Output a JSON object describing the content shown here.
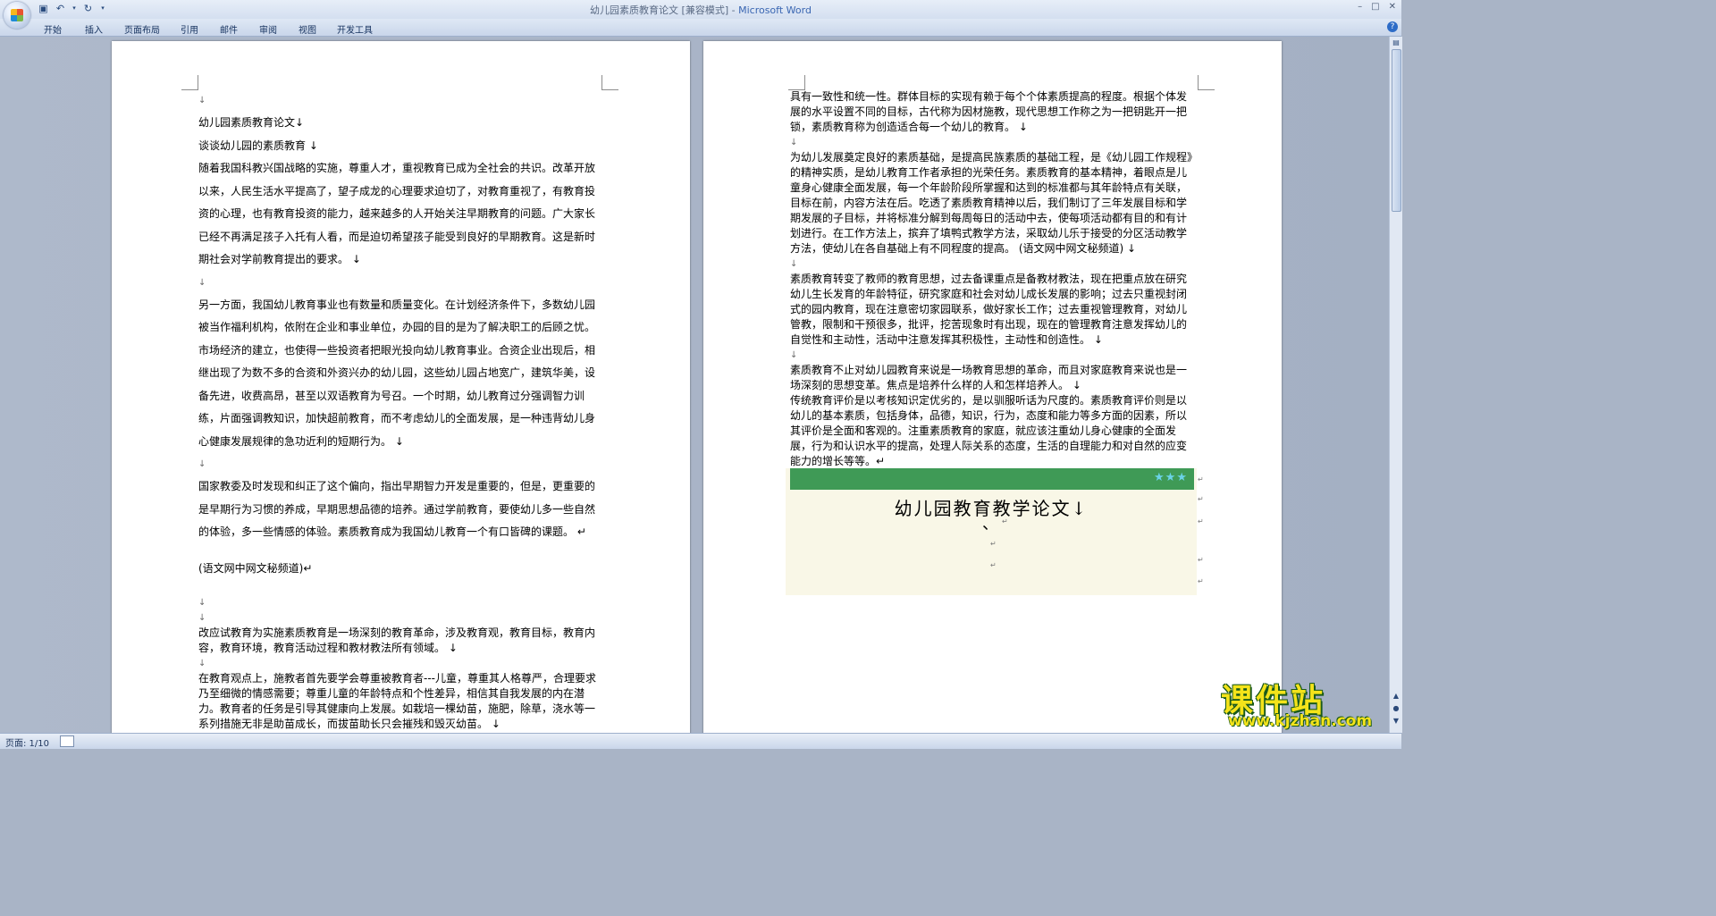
{
  "window": {
    "title": "幼儿园素质教育论文 [兼容模式] - ",
    "app_name": "Microsoft Word"
  },
  "ribbon": {
    "tabs": [
      "开始",
      "插入",
      "页面布局",
      "引用",
      "邮件",
      "审阅",
      "视图",
      "开发工具"
    ]
  },
  "page1": {
    "p1": "幼儿园素质教育论文↓",
    "p2": "谈谈幼儿园的素质教育 ↓",
    "p3": "随着我国科教兴国战略的实施，尊重人才，重视教育已成为全社会的共识。改革开放以来，人民生活水平提高了，望子成龙的心理要求迫切了，对教育重视了，有教育投资的心理，也有教育投资的能力，越来越多的人开始关注早期教育的问题。广大家长已经不再满足孩子入托有人看，而是迫切希望孩子能受到良好的早期教育。这是新时期社会对学前教育提出的要求。 ↓",
    "p4": "另一方面，我国幼儿教育事业也有数量和质量变化。在计划经济条件下，多数幼儿园被当作福利机构，依附在企业和事业单位，办园的目的是为了解决职工的后顾之忧。市场经济的建立，也使得一些投资者把眼光投向幼儿教育事业。合资企业出现后，相继出现了为数不多的合资和外资兴办的幼儿园，这些幼儿园占地宽广，建筑华美，设备先进，收费高昂，甚至以双语教育为号召。一个时期，幼儿教育过分强调智力训练，片面强调教知识，加快超前教育，而不考虑幼儿的全面发展，是一种违背幼儿身心健康发展规律的急功近利的短期行为。 ↓",
    "p5": "国家教委及时发现和纠正了这个偏向，指出早期智力开发是重要的，但是，更重要的是早期行为习惯的养成，早期思想品德的培养。通过学前教育，要使幼儿多一些自然的体验，多一些情感的体验。素质教育成为我国幼儿教育一个有口皆碑的课题。 ↵",
    "p6": "(语文网中网文秘频道)↵",
    "p7": "改应试教育为实施素质教育是一场深刻的教育革命，涉及教育观，教育目标，教育内容，教育环境，教育活动过程和教材教法所有领域。 ↓",
    "p8": "在教育观点上，施教者首先要学会尊重被教育者---儿童，尊重其人格尊严，合理要求乃至细微的情感需要；尊重儿童的年龄特点和个性差异，相信其自我发展的内在潜力。教育者的任务是引导其健康向上发展。如栽培一棵幼苗，施肥，除草，浇水等一系列措施无非是助苗成长，而拔苗助长只会摧残和毁灭幼苗。 ↓",
    "arrow": "↓"
  },
  "page2": {
    "q1": "具有一致性和统一性。群体目标的实现有赖于每个个体素质提高的程度。根据个体发展的水平设置不同的目标，古代称为因材施教，现代思想工作称之为一把钥匙开一把锁，素质教育称为创造适合每一个幼儿的教育。 ↓",
    "q2": "为幼儿发展奠定良好的素质基础，是提高民族素质的基础工程，是《幼儿园工作规程》的精神实质，是幼儿教育工作者承担的光荣任务。素质教育的基本精神，着眼点是儿童身心健康全面发展，每一个年龄阶段所掌握和达到的标准都与其年龄特点有关联，目标在前，内容方法在后。吃透了素质教育精神以后，我们制订了三年发展目标和学期发展的子目标，并将标准分解到每周每日的活动中去，使每项活动都有目的和有计划进行。在工作方法上，摈弃了填鸭式教学方法，采取幼儿乐于接受的分区活动教学方法，使幼儿在各自基础上有不同程度的提高。 (语文网中网文秘频道) ↓",
    "q3": "素质教育转变了教师的教育思想，过去备课重点是备教材教法，现在把重点放在研究幼儿生长发育的年龄特征，研究家庭和社会对幼儿成长发展的影响；过去只重视封闭式的园内教育，现在注意密切家园联系，做好家长工作；过去重视管理教育，对幼儿管教，限制和干预很多，批评，挖苦现象时有出现，现在的管理教育注意发挥幼儿的自觉性和主动性，活动中注意发挥其积极性，主动性和创造性。 ↓",
    "q4": "素质教育不止对幼儿园教育来说是一场教育思想的革命，而且对家庭教育来说也是一场深刻的思想变革。焦点是培养什么样的人和怎样培养人。 ↓",
    "q5": "传统教育评价是以考核知识定优劣的，是以驯服听话为尺度的。素质教育评价则是以幼儿的基本素质，包括身体，品德，知识，行为，态度和能力等多方面的因素，所以其评价是全面和客观的。注重素质教育的家庭，就应该注重幼儿身心健康的全面发展，行为和认识水平的提高，处理人际关系的态度，生活的自理能力和对自然的应变能力的增长等等。↵",
    "arrow": "↓",
    "card": {
      "stars": "★★★",
      "title": "幼儿园教育教学论文↓",
      "tick": "、",
      "ret": "↵"
    }
  },
  "statusbar": {
    "page": "页面: 1/10"
  },
  "watermark": {
    "text": "课件站",
    "url": "www.kjzhan.com"
  }
}
